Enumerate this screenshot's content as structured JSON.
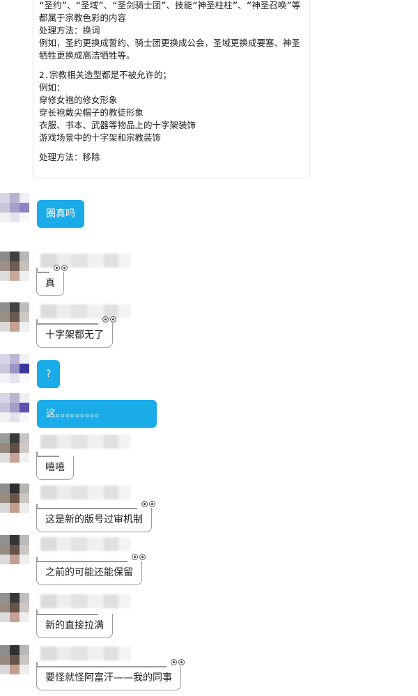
{
  "document_card": {
    "lines_a": [
      "“圣约”、“圣域”、“圣剑骑士团”、技能“神圣柱柱”、“神圣召唤”等",
      "都属于宗教色彩的内容",
      "处理方法：换词",
      "例如，圣约更换成誓约、骑士团更换成公会，圣域更换成要塞、神圣",
      "牺牲更换成高洁牺牲等。"
    ],
    "lines_b": [
      "2.宗教相关造型都是不被允许的；",
      "例如：",
      "穿修女袍的修女形象",
      "穿长袍戴尖帽子的教徒形象",
      "衣服、书本、武器等物品上的十字架装饰",
      "游戏场景中的十字架和宗教装饰"
    ],
    "handling": "处理方法：移除"
  },
  "messages": [
    {
      "sender": "self",
      "text": "圈真吗"
    },
    {
      "sender": "other",
      "text": "真"
    },
    {
      "sender": "other",
      "text": "十字架都无了"
    },
    {
      "sender": "self",
      "text": "?"
    },
    {
      "sender": "self",
      "text": "这。。。。。。。。。"
    },
    {
      "sender": "other",
      "text": "嘻嘻"
    },
    {
      "sender": "other",
      "text": "这是新的版号过审机制"
    },
    {
      "sender": "other",
      "text": "之前的可能还能保留"
    },
    {
      "sender": "other",
      "text": "新的直接拉满"
    },
    {
      "sender": "other",
      "text": "要怪就怪阿富汗——我的同事"
    }
  ],
  "colors": {
    "self_bubble": "#1aabe9",
    "self_text": "#ffffff",
    "other_bubble_border": "#9a9a9a",
    "background": "#ffffff"
  },
  "icons": {
    "bubble_decoration": "cartoon-eyes-icon",
    "avatar": "pixelated-avatar"
  }
}
